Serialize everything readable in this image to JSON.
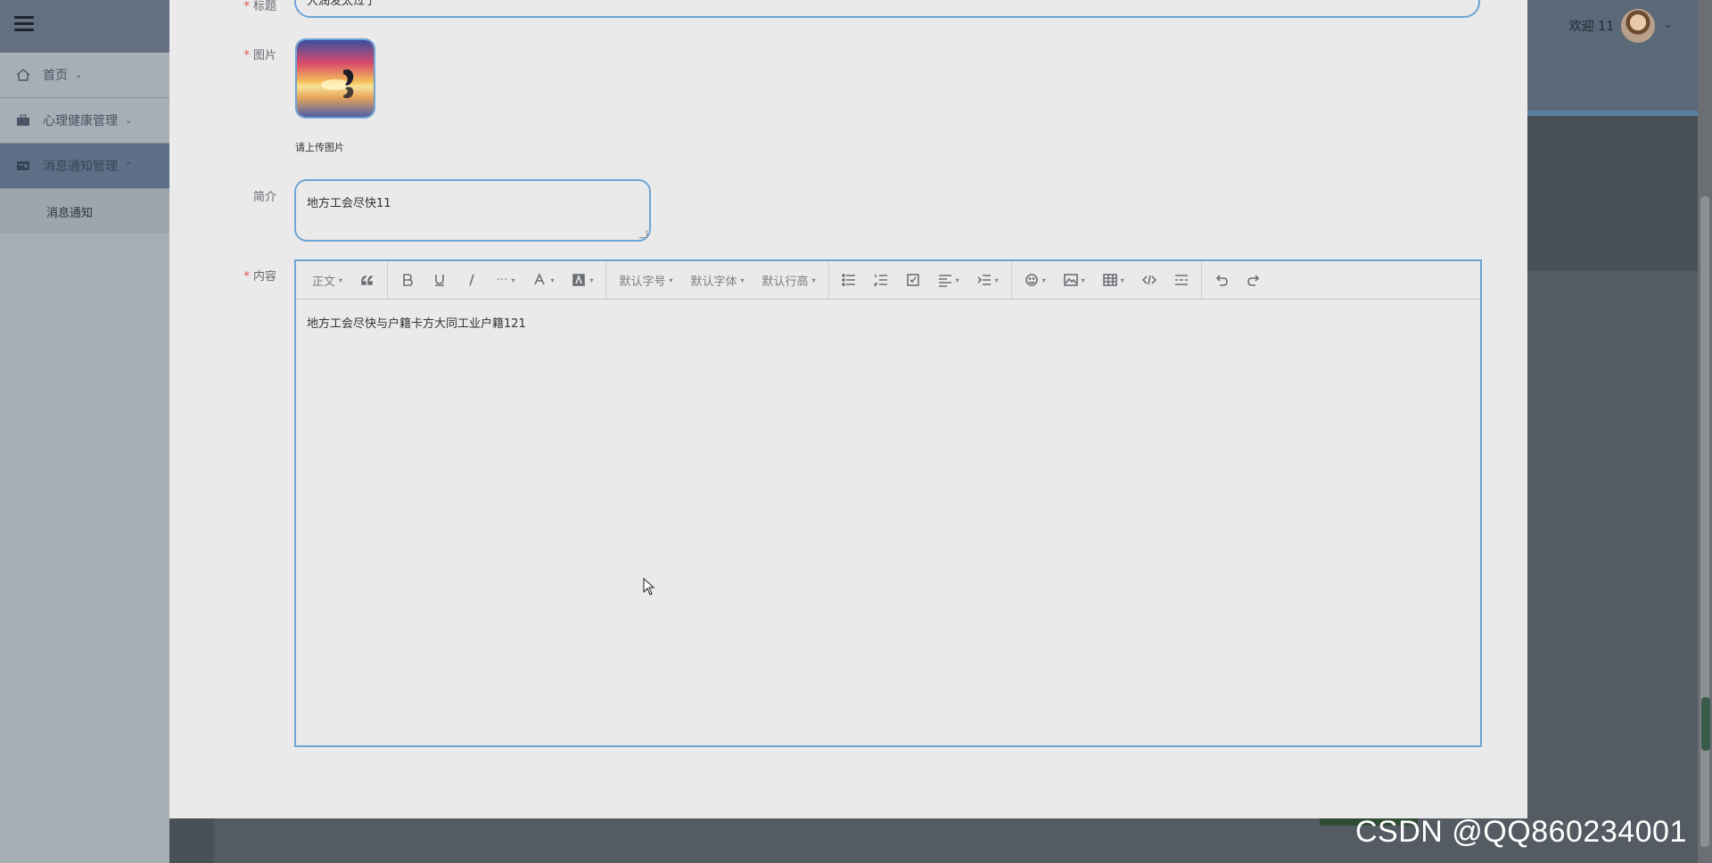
{
  "header": {
    "greeting": "欢迎 11"
  },
  "sidebar": {
    "items": [
      {
        "label": "首页",
        "icon": "home-icon"
      },
      {
        "label": "心理健康管理",
        "icon": "briefcase-icon"
      },
      {
        "label": "消息通知管理",
        "icon": "id-card-icon"
      }
    ],
    "submenu": [
      {
        "label": "消息通知"
      }
    ]
  },
  "form": {
    "title": {
      "label": "标题",
      "value": "大润发太过于"
    },
    "image": {
      "label": "图片",
      "hint": "请上传图片"
    },
    "intro": {
      "label": "简介",
      "value": "地方工会尽快11"
    },
    "content": {
      "label": "内容",
      "value": "地方工会尽快与户籍卡方大同工业户籍121",
      "toolbar": {
        "paragraph": "正文",
        "font_size": "默认字号",
        "font_family": "默认字体",
        "line_height": "默认行高"
      }
    }
  },
  "watermark": "CSDN @QQ860234001",
  "colors": {
    "border_focus": "#6ea4d4",
    "required": "#e04a4a",
    "modal_bg": "#eaeaea"
  }
}
